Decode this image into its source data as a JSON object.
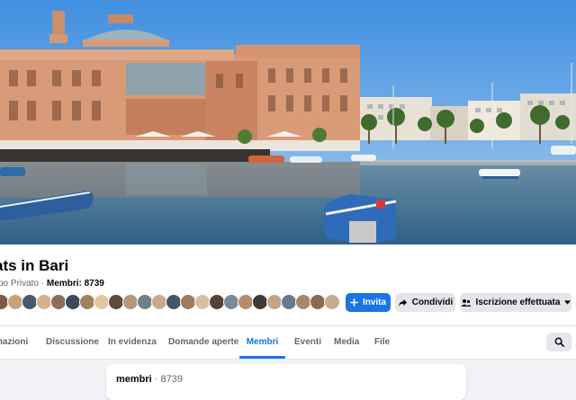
{
  "group": {
    "title": "ats in Bari",
    "privacy": "po Privato",
    "separator": " · ",
    "members_label": "Membri:",
    "members_value": "8739"
  },
  "avatars": [
    "#7a5c48",
    "#c9a27e",
    "#4a5968",
    "#d6b08c",
    "#8d6e5a",
    "#3b4b5c",
    "#a08462",
    "#e2c7a4",
    "#5c4b3e",
    "#b59677",
    "#6f7f8c",
    "#caa98a",
    "#475663",
    "#9c7b61",
    "#d8bfa0",
    "#564438",
    "#7b8c99",
    "#b28e6c",
    "#3f3a37",
    "#c3a586",
    "#69788a",
    "#a6896d",
    "#8c6a52",
    "#c7ab8c"
  ],
  "actions": {
    "invite": "Invita",
    "share": "Condividi",
    "joined": "Iscrizione effettuata"
  },
  "tabs": [
    {
      "label": "mazioni"
    },
    {
      "label": "Discussione"
    },
    {
      "label": "In evidenza"
    },
    {
      "label": "Domande aperte"
    },
    {
      "label": "Membri",
      "active": true
    },
    {
      "label": "Eventi"
    },
    {
      "label": "Media"
    },
    {
      "label": "File"
    }
  ],
  "members_card": {
    "label": "membri",
    "separator": " · ",
    "count": "8739"
  },
  "colors": {
    "accent": "#1b74e4",
    "secondary_button": "#e4e6eb",
    "page_background": "#f0f2f5"
  }
}
